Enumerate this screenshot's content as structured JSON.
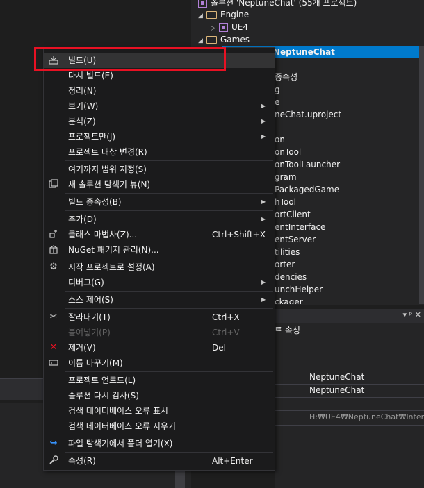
{
  "solution_explorer": {
    "solution_label": "솔루션 'NeptuneChat' (55개 프로젝트)",
    "engine_folder": "Engine",
    "ue4_project": "UE4",
    "games_folder": "Games",
    "selected_project": "NeptuneChat",
    "partial_items": [
      "종속성",
      "g",
      "e",
      "neChat.uproject",
      "on",
      "onTool",
      "onToolLauncher",
      "gram",
      "PackagedGame",
      "hTool",
      "ortClient",
      "entInterface",
      "entServer",
      "tilities",
      "orter",
      "dencies",
      "unchHelper",
      "ckager"
    ]
  },
  "properties": {
    "header_controls": "▾ ᵖ ✕",
    "title": "트 속성",
    "values": [
      "NeptuneChat",
      "NeptuneChat",
      "H:₩UE4₩NeptuneChat₩Interm"
    ]
  },
  "context_menu": {
    "items": [
      {
        "label": "빌드(U)",
        "shortcut": "",
        "icon": "build-icon",
        "submenu": false,
        "disabled": false
      },
      {
        "label": "다시 빌드(E)",
        "shortcut": "",
        "icon": "",
        "submenu": false,
        "disabled": false
      },
      {
        "label": "정리(N)",
        "shortcut": "",
        "icon": "",
        "submenu": false,
        "disabled": false
      },
      {
        "label": "보기(W)",
        "shortcut": "",
        "icon": "",
        "submenu": true,
        "disabled": false
      },
      {
        "label": "분석(Z)",
        "shortcut": "",
        "icon": "",
        "submenu": true,
        "disabled": false
      },
      {
        "label": "프로젝트만(J)",
        "shortcut": "",
        "icon": "",
        "submenu": true,
        "disabled": false
      },
      {
        "label": "프로젝트 대상 변경(R)",
        "shortcut": "",
        "icon": "",
        "submenu": false,
        "disabled": false
      },
      {
        "label": "여기까지 범위 지정(S)",
        "shortcut": "",
        "icon": "",
        "submenu": false,
        "disabled": false
      },
      {
        "label": "새 솔루션 탐색기 뷰(N)",
        "shortcut": "",
        "icon": "new-view-icon",
        "submenu": false,
        "disabled": false
      },
      {
        "label": "빌드 종속성(B)",
        "shortcut": "",
        "icon": "",
        "submenu": true,
        "disabled": false
      },
      {
        "label": "추가(D)",
        "shortcut": "",
        "icon": "",
        "submenu": true,
        "disabled": false
      },
      {
        "label": "클래스 마법사(Z)...",
        "shortcut": "Ctrl+Shift+X",
        "icon": "class-wizard-icon",
        "submenu": false,
        "disabled": false
      },
      {
        "label": "NuGet 패키지 관리(N)...",
        "shortcut": "",
        "icon": "nuget-icon",
        "submenu": false,
        "disabled": false
      },
      {
        "label": "시작 프로젝트로 설정(A)",
        "shortcut": "",
        "icon": "gear-icon",
        "submenu": false,
        "disabled": false
      },
      {
        "label": "디버그(G)",
        "shortcut": "",
        "icon": "",
        "submenu": true,
        "disabled": false
      },
      {
        "label": "소스 제어(S)",
        "shortcut": "",
        "icon": "",
        "submenu": true,
        "disabled": false
      },
      {
        "label": "잘라내기(T)",
        "shortcut": "Ctrl+X",
        "icon": "scissors-icon",
        "submenu": false,
        "disabled": false
      },
      {
        "label": "붙여넣기(P)",
        "shortcut": "Ctrl+V",
        "icon": "",
        "submenu": false,
        "disabled": true
      },
      {
        "label": "제거(V)",
        "shortcut": "Del",
        "icon": "delete-icon",
        "submenu": false,
        "disabled": false
      },
      {
        "label": "이름 바꾸기(M)",
        "shortcut": "",
        "icon": "rename-icon",
        "submenu": false,
        "disabled": false
      },
      {
        "label": "프로젝트 언로드(L)",
        "shortcut": "",
        "icon": "",
        "submenu": false,
        "disabled": false
      },
      {
        "label": "솔루션 다시 검사(S)",
        "shortcut": "",
        "icon": "",
        "submenu": false,
        "disabled": false
      },
      {
        "label": "검색 데이터베이스 오류 표시",
        "shortcut": "",
        "icon": "",
        "submenu": false,
        "disabled": false
      },
      {
        "label": "검색 데이터베이스 오류 지우기",
        "shortcut": "",
        "icon": "",
        "submenu": false,
        "disabled": false
      },
      {
        "label": "파일 탐색기에서 폴더 열기(X)",
        "shortcut": "",
        "icon": "open-folder-icon",
        "submenu": false,
        "disabled": false
      },
      {
        "label": "속성(R)",
        "shortcut": "Alt+Enter",
        "icon": "wrench-icon",
        "submenu": false,
        "disabled": false
      }
    ]
  },
  "colors": {
    "accent": "#007acc",
    "highlight_box": "#e81123",
    "menu_bg": "#1b1b1c"
  }
}
